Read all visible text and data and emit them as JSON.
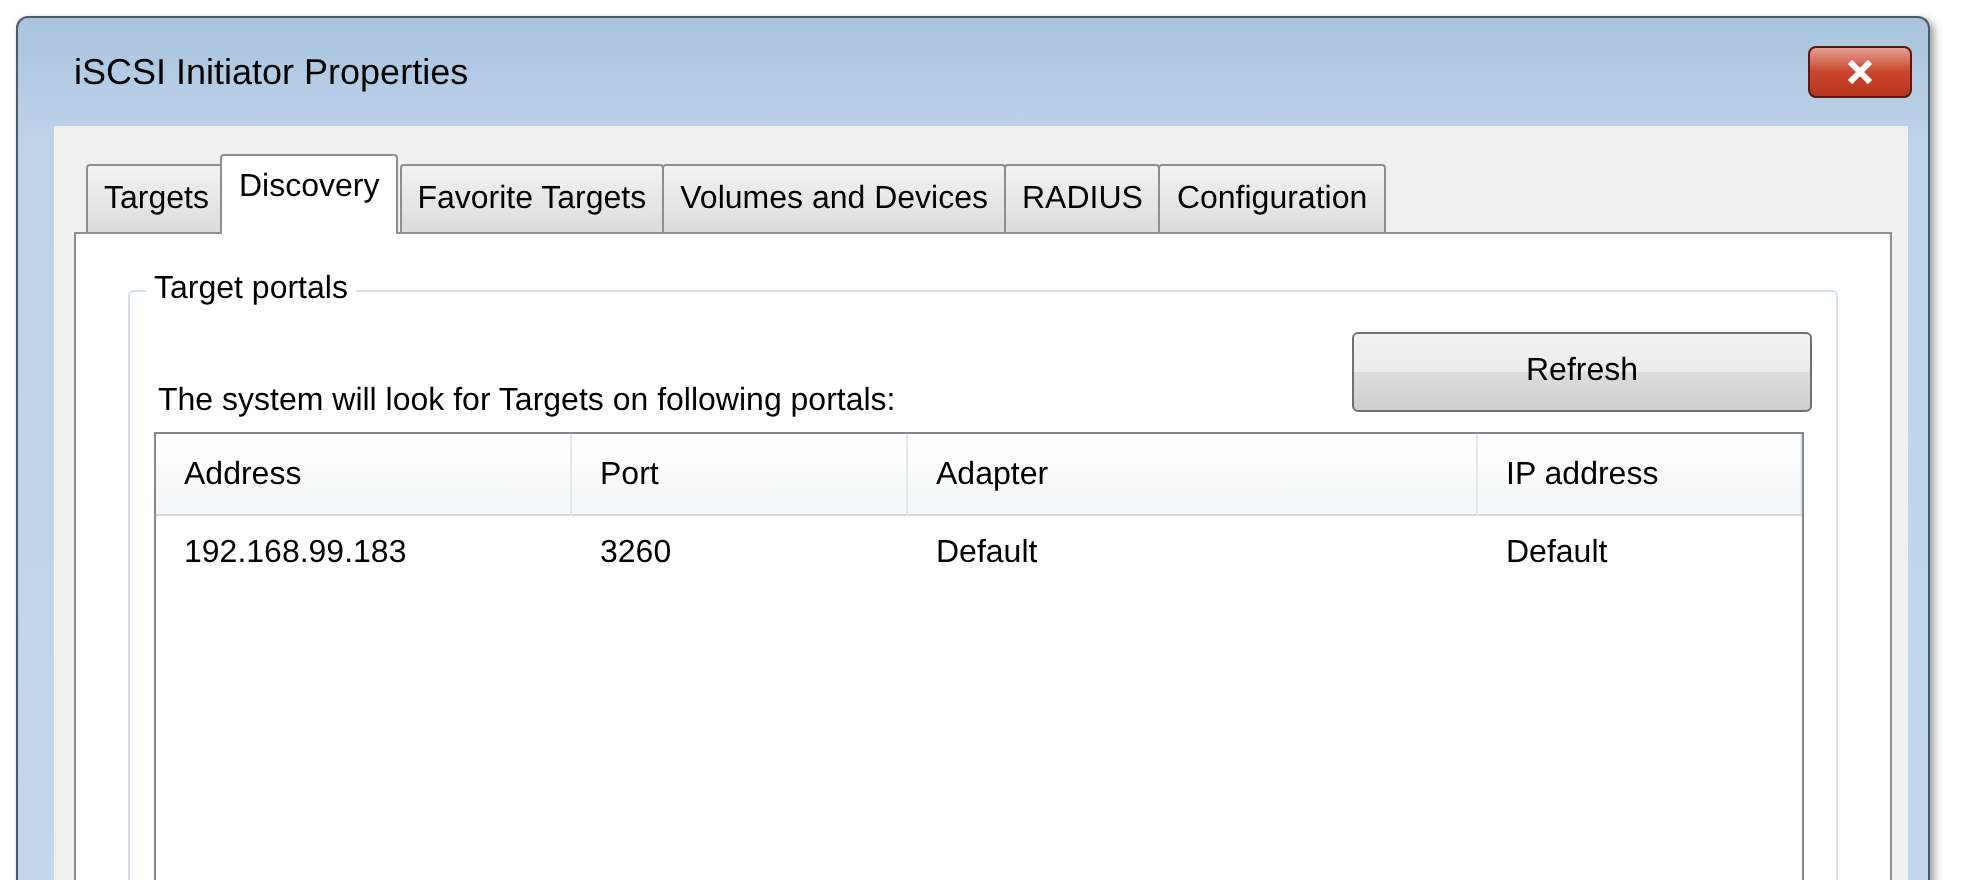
{
  "window": {
    "title": "iSCSI Initiator Properties"
  },
  "tabs": [
    {
      "label": "Targets",
      "selected": false
    },
    {
      "label": "Discovery",
      "selected": true
    },
    {
      "label": "Favorite Targets",
      "selected": false
    },
    {
      "label": "Volumes and Devices",
      "selected": false
    },
    {
      "label": "RADIUS",
      "selected": false
    },
    {
      "label": "Configuration",
      "selected": false
    }
  ],
  "group": {
    "title": "Target portals",
    "description": "The system will look for Targets on following portals:",
    "refresh_button": "Refresh"
  },
  "table": {
    "columns": [
      "Address",
      "Port",
      "Adapter",
      "IP address"
    ],
    "rows": [
      [
        "192.168.99.183",
        "3260",
        "Default",
        "Default"
      ]
    ]
  }
}
